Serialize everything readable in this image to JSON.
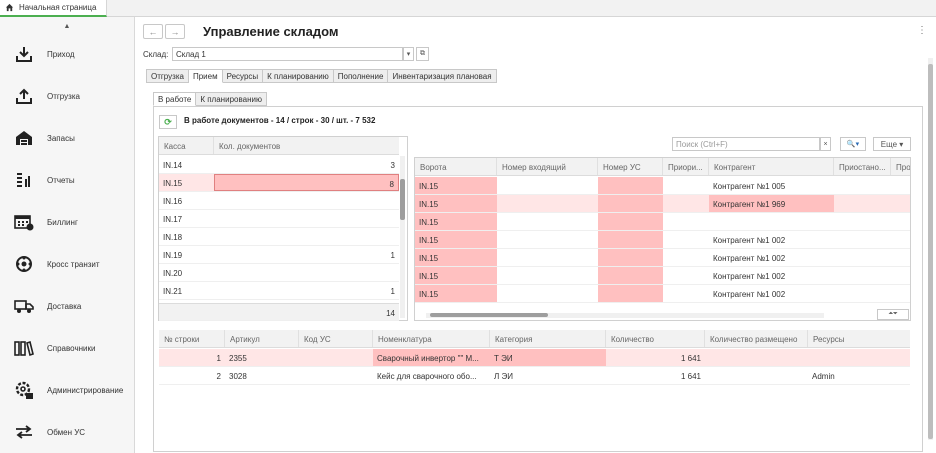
{
  "top_tab": {
    "label": "Начальная страница"
  },
  "sidebar": {
    "items": [
      {
        "label": "Приход",
        "icon": "download-icon"
      },
      {
        "label": "Отгрузка",
        "icon": "upload-icon"
      },
      {
        "label": "Запасы",
        "icon": "warehouse-icon"
      },
      {
        "label": "Отчеты",
        "icon": "report-icon"
      },
      {
        "label": "Биллинг",
        "icon": "calendar-icon"
      },
      {
        "label": "Кросс транзит",
        "icon": "cross-transit-icon"
      },
      {
        "label": "Доставка",
        "icon": "truck-icon"
      },
      {
        "label": "Справочники",
        "icon": "books-icon"
      },
      {
        "label": "Администрирование",
        "icon": "admin-gear-icon"
      },
      {
        "label": "Обмен УС",
        "icon": "exchange-icon"
      }
    ]
  },
  "header": {
    "title": "Управление складом"
  },
  "warehouse": {
    "label": "Склад:",
    "value": "Склад 1"
  },
  "main_tabs": [
    "Отгрузка",
    "Прием",
    "Ресурсы",
    "К планированию",
    "Пополнение",
    "Инвентаризация плановая"
  ],
  "sub_tabs": [
    "В работе",
    "К планированию"
  ],
  "summary": "В работе документов - 14 / строк - 30 / шт. - 7 532",
  "kassa_table": {
    "columns": [
      "Касса",
      "Кол. документов"
    ],
    "rows": [
      {
        "kassa": "IN.14",
        "count": "3"
      },
      {
        "kassa": "IN.15",
        "count": "8"
      },
      {
        "kassa": "IN.16",
        "count": ""
      },
      {
        "kassa": "IN.17",
        "count": ""
      },
      {
        "kassa": "IN.18",
        "count": ""
      },
      {
        "kassa": "IN.19",
        "count": "1"
      },
      {
        "kassa": "IN.20",
        "count": ""
      },
      {
        "kassa": "IN.21",
        "count": "1"
      }
    ],
    "footer_total": "14"
  },
  "search": {
    "placeholder": "Поиск (Ctrl+F)",
    "more_label": "Еще"
  },
  "docs_table": {
    "columns": [
      "Ворота",
      "Номер входящий",
      "Номер УС",
      "Приори...",
      "Контрагент",
      "Приостано...",
      "Про"
    ],
    "rows": [
      {
        "gate": "IN.15",
        "incoming": "",
        "us": "",
        "prio": "",
        "contractor": "Контрагент №1 005"
      },
      {
        "gate": "IN.15",
        "incoming": "",
        "us": "",
        "prio": "",
        "contractor": "Контрагент №1 969"
      },
      {
        "gate": "IN.15",
        "incoming": "",
        "us": "",
        "prio": "",
        "contractor": ""
      },
      {
        "gate": "IN.15",
        "incoming": "",
        "us": "",
        "prio": "",
        "contractor": "Контрагент №1 002"
      },
      {
        "gate": "IN.15",
        "incoming": "",
        "us": "",
        "prio": "",
        "contractor": "Контрагент №1 002"
      },
      {
        "gate": "IN.15",
        "incoming": "",
        "us": "",
        "prio": "",
        "contractor": "Контрагент №1 002"
      },
      {
        "gate": "IN.15",
        "incoming": "",
        "us": "",
        "prio": "",
        "contractor": "Контрагент №1 002"
      }
    ]
  },
  "lines_table": {
    "columns": [
      "№ строки",
      "Артикул",
      "Код УС",
      "Номенклатура",
      "Категория",
      "Количество",
      "Количество размещено",
      "Ресурсы"
    ],
    "rows": [
      {
        "n": "1",
        "article": "2355",
        "code": "",
        "nomenclature": "Сварочный инвертор \"\" М...",
        "category": "Т ЭИ",
        "qty": "1 641",
        "placed": "",
        "resources": ""
      },
      {
        "n": "2",
        "article": "3028",
        "code": "",
        "nomenclature": "Кейс для сварочного обо...",
        "category": "Л ЭИ",
        "qty": "1 641",
        "placed": "",
        "resources": "Admin"
      }
    ]
  },
  "colors": {
    "accent_green": "#4caf50",
    "highlight_pink": "#ffc0c0",
    "light_pink": "#ffe6e6"
  }
}
